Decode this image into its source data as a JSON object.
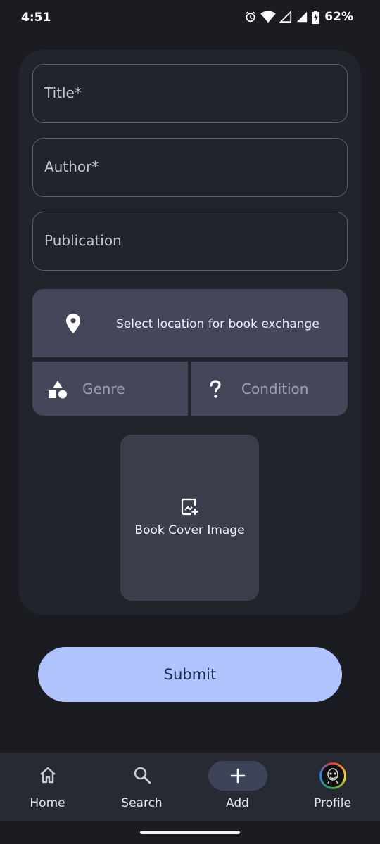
{
  "status_bar": {
    "time": "4:51",
    "battery": "62%"
  },
  "form": {
    "title_placeholder": "Title*",
    "author_placeholder": "Author*",
    "publication_placeholder": "Publication",
    "location_label": "Select location for book exchange",
    "genre_label": "Genre",
    "condition_label": "Condition",
    "cover_label": "Book Cover Image",
    "submit_label": "Submit"
  },
  "nav": {
    "items": [
      {
        "label": "Home",
        "icon": "home-icon"
      },
      {
        "label": "Search",
        "icon": "search-icon"
      },
      {
        "label": "Add",
        "icon": "plus-icon",
        "selected": true
      },
      {
        "label": "Profile",
        "icon": "avatar"
      }
    ]
  },
  "colors": {
    "background": "#1b1c21",
    "card": "#22242c",
    "button_surface": "#434759",
    "submit": "#afc3fd",
    "nav_bar": "#272a33"
  }
}
